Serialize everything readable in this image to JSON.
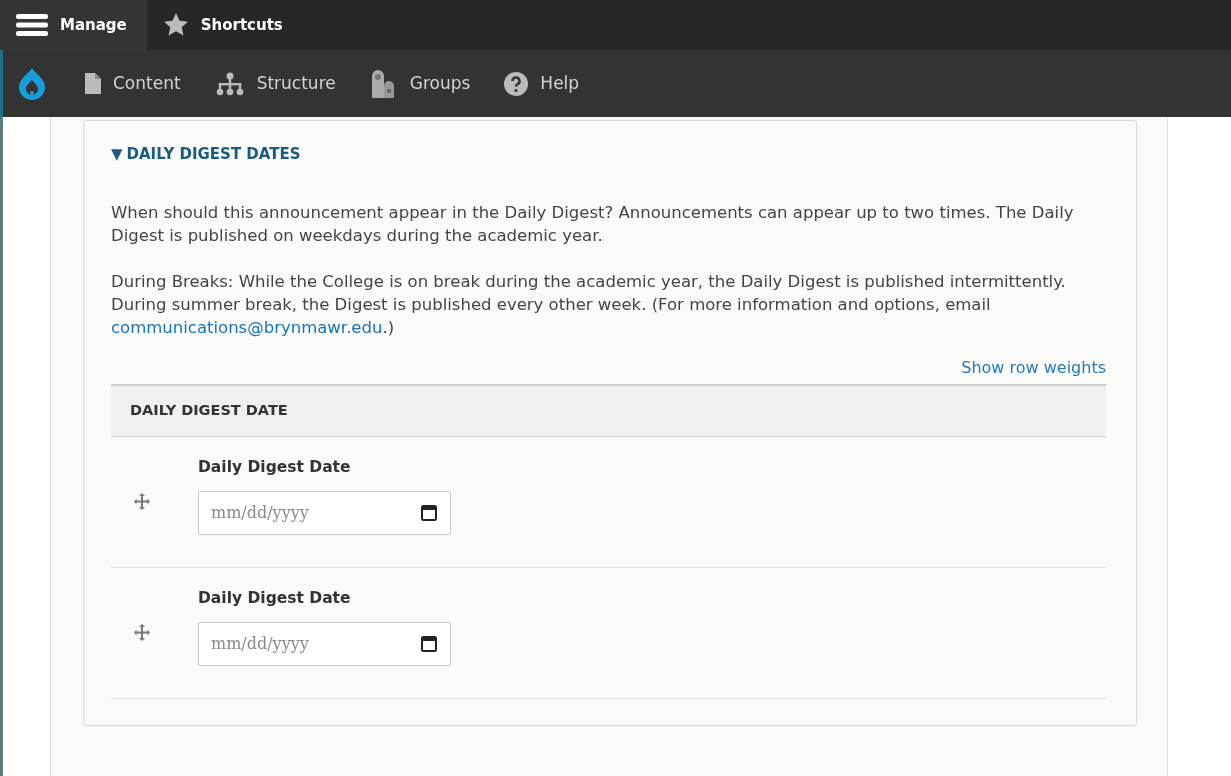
{
  "toolbar_tabs": [
    {
      "label": "Manage",
      "selected": true
    },
    {
      "label": "Shortcuts",
      "selected": false
    }
  ],
  "admin_menu": [
    {
      "label": "Content"
    },
    {
      "label": "Structure"
    },
    {
      "label": "Groups"
    },
    {
      "label": "Help"
    }
  ],
  "fieldset": {
    "legend_marker": "▼",
    "legend": "DAILY DIGEST DATES",
    "expanded": true,
    "paragraphs": [
      {
        "text": "When should this announcement appear in the Daily Digest? Announcements can appear up to two times. The Daily Digest is published on weekdays during the academic year."
      },
      {
        "text": "During Breaks: While the College is on break during the academic year, the Daily Digest is published intermittently. During summer break, the Digest is published every other week. (For more information and options, email ",
        "link": "communications@brynmawr.edu",
        "after": ".)"
      }
    ],
    "row_weights_link": "Show row weights",
    "table_header": "DAILY DIGEST DATE",
    "rows": [
      {
        "label": "Daily Digest Date",
        "placeholder": "mm/dd/yyyy"
      },
      {
        "label": "Daily Digest Date",
        "placeholder": "mm/dd/yyyy"
      }
    ]
  }
}
